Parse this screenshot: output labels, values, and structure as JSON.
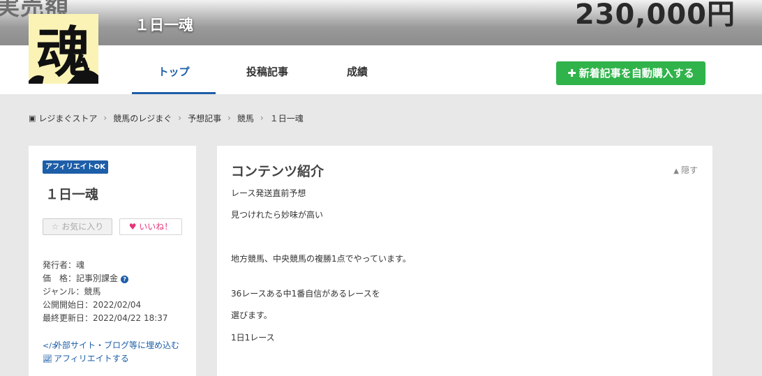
{
  "banner": {
    "left_text": "実売額",
    "right_text": "230,000円",
    "title": "１日一魂"
  },
  "logo": {
    "glyph": "魂",
    "bg_color": "#fbf3b6"
  },
  "nav": {
    "tabs": [
      {
        "label": "トップ",
        "active": true
      },
      {
        "label": "投稿記事",
        "active": false
      },
      {
        "label": "成績",
        "active": false
      }
    ],
    "buy_button": "新着記事を自動購入する",
    "accent_color": "#1d5ea8",
    "buy_color": "#2fb34a"
  },
  "breadcrumb": [
    "レジまぐストア",
    "競馬のレジまぐ",
    "予想記事",
    "競馬",
    "１日一魂"
  ],
  "sidebar": {
    "badge": "アフィリエイトOK",
    "title": "１日一魂",
    "favorite_button": "お気に入り",
    "like_button": "いいね！",
    "publisher": "発行者：魂",
    "price": "価　格：記事別課金",
    "genre": "ジャンル：競馬",
    "published": "公開開始日：2022/02/04",
    "updated": "最終更新日：2022/04/22 18:37",
    "embed_link": "外部サイト・ブログ等に埋め込む",
    "affiliate_link": "アフィリエイトする"
  },
  "content": {
    "section_title": "コンテンツ紹介",
    "hide_label": "隠す",
    "lines": [
      "レース発送直前予想",
      "見つけれたら妙味が高い",
      "地方競馬、中央競馬の複勝1点でやっています。",
      "36レースある中1番自信があるレースを",
      "選びます。",
      "1日1レース"
    ]
  }
}
